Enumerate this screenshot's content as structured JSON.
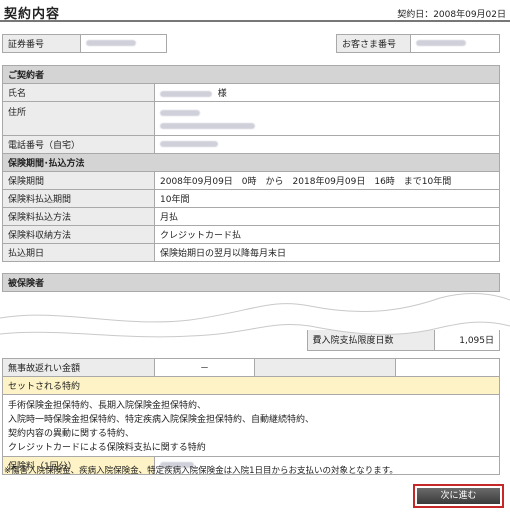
{
  "header": {
    "title": "契約内容",
    "contract_date": "契約日：2008年09月02日"
  },
  "policy": {
    "policy_number_label": "証券番号",
    "customer_number_label": "お客さま番号"
  },
  "contractor": {
    "section_label": "ご契約者",
    "name_label": "氏名",
    "name_suffix": "様",
    "address_label": "住所",
    "phone_label": "電話番号（自宅）"
  },
  "period": {
    "section_label": "保険期間･払込方法",
    "rows": [
      {
        "label": "保険期間",
        "value": "2008年09月09日　0時　から　2018年09月09日　16時　まで10年間"
      },
      {
        "label": "保険料払込期間",
        "value": "10年間"
      },
      {
        "label": "保険料払込方法",
        "value": "月払"
      },
      {
        "label": "保険料収納方法",
        "value": "クレジットカード払"
      },
      {
        "label": "払込期日",
        "value": "保険始期日の翌月以降毎月末日"
      }
    ]
  },
  "insured": {
    "section_label": "被保険者",
    "partial_label": "費入院支払限度日数",
    "partial_value": "1,095日",
    "no_claim_label": "無事故返れい金額",
    "no_claim_value": "－"
  },
  "riders": {
    "section_label": "セットされる特約",
    "lines": [
      "手術保険金担保特約、長期入院保険金担保特約、",
      "入院時一時保険金担保特約、特定疾病入院保険金担保特約、自動継続特約、",
      "契約内容の異動に関する特約、",
      "クレジットカードによる保険料支払に関する特約"
    ],
    "premium_label": "保険料（1回分）"
  },
  "footnote": "※傷害入院保険金、疾病入院保険金、特定疾病入院保険金は入院1日目からお支払いの対象となります。",
  "actions": {
    "next_label": "次に進む"
  }
}
